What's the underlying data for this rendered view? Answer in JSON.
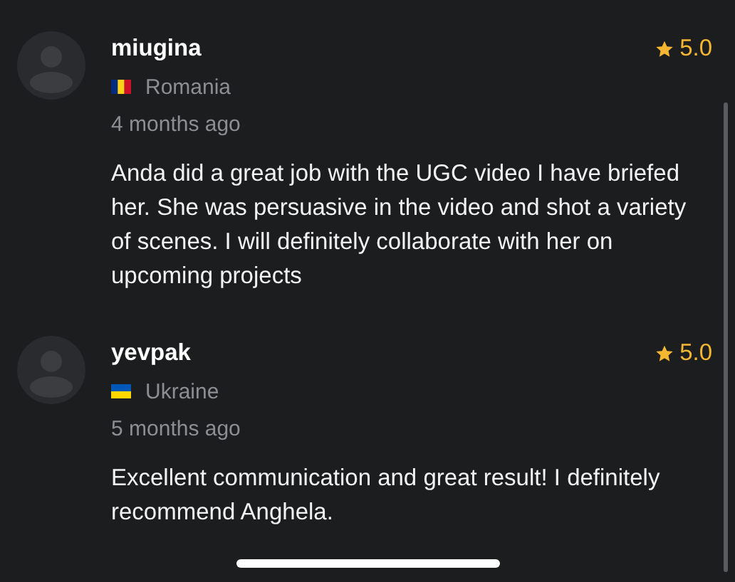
{
  "reviews": [
    {
      "name": "miugina",
      "rating": "5.0",
      "country": "Romania",
      "flag": {
        "kind": "ro"
      },
      "time": "4 months ago",
      "text": "Anda did a great job with the UGC video I have briefed her. She was persuasive in the video and shot a variety of scenes. I will definitely collaborate with her on upcoming projects"
    },
    {
      "name": "yevpak",
      "rating": "5.0",
      "country": "Ukraine",
      "flag": {
        "kind": "ua"
      },
      "time": "5 months ago",
      "text": "Excellent communication and great result! I definitely recommend Anghela."
    }
  ]
}
